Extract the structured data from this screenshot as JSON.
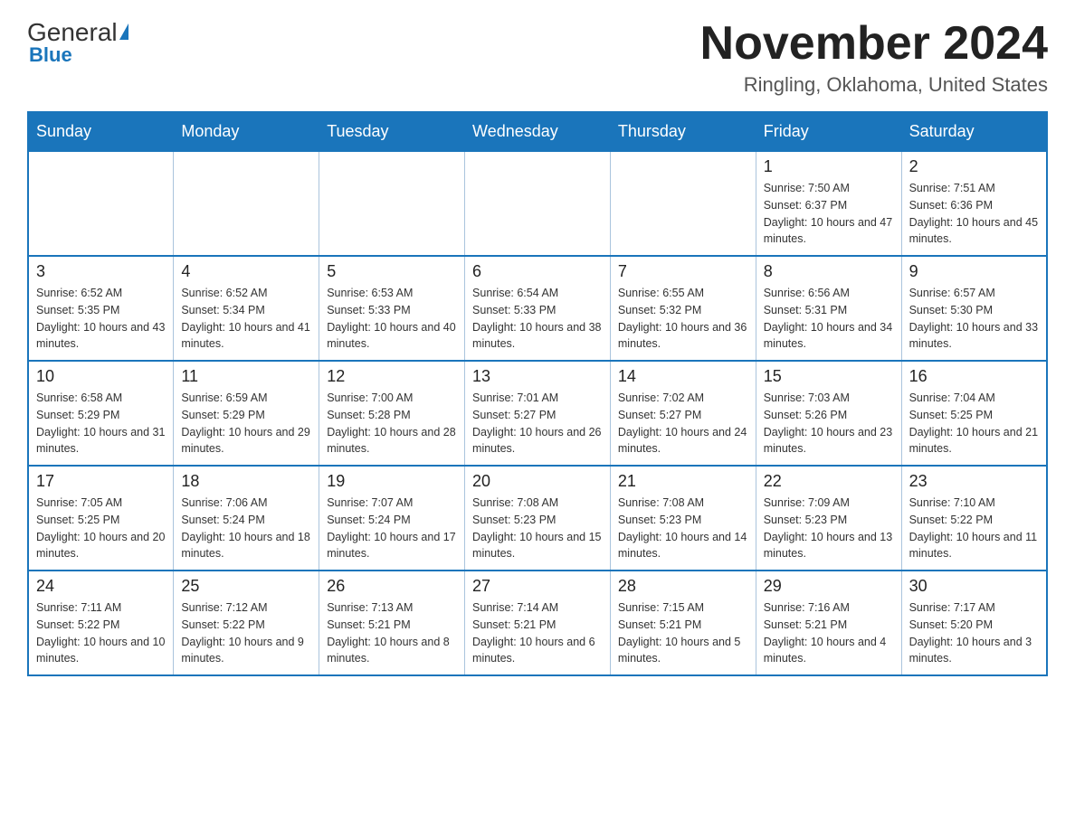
{
  "header": {
    "logo_general": "General",
    "logo_blue": "Blue",
    "month_title": "November 2024",
    "location": "Ringling, Oklahoma, United States"
  },
  "days_of_week": [
    "Sunday",
    "Monday",
    "Tuesday",
    "Wednesday",
    "Thursday",
    "Friday",
    "Saturday"
  ],
  "weeks": [
    {
      "cells": [
        {
          "day": "",
          "info": ""
        },
        {
          "day": "",
          "info": ""
        },
        {
          "day": "",
          "info": ""
        },
        {
          "day": "",
          "info": ""
        },
        {
          "day": "",
          "info": ""
        },
        {
          "day": "1",
          "info": "Sunrise: 7:50 AM\nSunset: 6:37 PM\nDaylight: 10 hours and 47 minutes."
        },
        {
          "day": "2",
          "info": "Sunrise: 7:51 AM\nSunset: 6:36 PM\nDaylight: 10 hours and 45 minutes."
        }
      ]
    },
    {
      "cells": [
        {
          "day": "3",
          "info": "Sunrise: 6:52 AM\nSunset: 5:35 PM\nDaylight: 10 hours and 43 minutes."
        },
        {
          "day": "4",
          "info": "Sunrise: 6:52 AM\nSunset: 5:34 PM\nDaylight: 10 hours and 41 minutes."
        },
        {
          "day": "5",
          "info": "Sunrise: 6:53 AM\nSunset: 5:33 PM\nDaylight: 10 hours and 40 minutes."
        },
        {
          "day": "6",
          "info": "Sunrise: 6:54 AM\nSunset: 5:33 PM\nDaylight: 10 hours and 38 minutes."
        },
        {
          "day": "7",
          "info": "Sunrise: 6:55 AM\nSunset: 5:32 PM\nDaylight: 10 hours and 36 minutes."
        },
        {
          "day": "8",
          "info": "Sunrise: 6:56 AM\nSunset: 5:31 PM\nDaylight: 10 hours and 34 minutes."
        },
        {
          "day": "9",
          "info": "Sunrise: 6:57 AM\nSunset: 5:30 PM\nDaylight: 10 hours and 33 minutes."
        }
      ]
    },
    {
      "cells": [
        {
          "day": "10",
          "info": "Sunrise: 6:58 AM\nSunset: 5:29 PM\nDaylight: 10 hours and 31 minutes."
        },
        {
          "day": "11",
          "info": "Sunrise: 6:59 AM\nSunset: 5:29 PM\nDaylight: 10 hours and 29 minutes."
        },
        {
          "day": "12",
          "info": "Sunrise: 7:00 AM\nSunset: 5:28 PM\nDaylight: 10 hours and 28 minutes."
        },
        {
          "day": "13",
          "info": "Sunrise: 7:01 AM\nSunset: 5:27 PM\nDaylight: 10 hours and 26 minutes."
        },
        {
          "day": "14",
          "info": "Sunrise: 7:02 AM\nSunset: 5:27 PM\nDaylight: 10 hours and 24 minutes."
        },
        {
          "day": "15",
          "info": "Sunrise: 7:03 AM\nSunset: 5:26 PM\nDaylight: 10 hours and 23 minutes."
        },
        {
          "day": "16",
          "info": "Sunrise: 7:04 AM\nSunset: 5:25 PM\nDaylight: 10 hours and 21 minutes."
        }
      ]
    },
    {
      "cells": [
        {
          "day": "17",
          "info": "Sunrise: 7:05 AM\nSunset: 5:25 PM\nDaylight: 10 hours and 20 minutes."
        },
        {
          "day": "18",
          "info": "Sunrise: 7:06 AM\nSunset: 5:24 PM\nDaylight: 10 hours and 18 minutes."
        },
        {
          "day": "19",
          "info": "Sunrise: 7:07 AM\nSunset: 5:24 PM\nDaylight: 10 hours and 17 minutes."
        },
        {
          "day": "20",
          "info": "Sunrise: 7:08 AM\nSunset: 5:23 PM\nDaylight: 10 hours and 15 minutes."
        },
        {
          "day": "21",
          "info": "Sunrise: 7:08 AM\nSunset: 5:23 PM\nDaylight: 10 hours and 14 minutes."
        },
        {
          "day": "22",
          "info": "Sunrise: 7:09 AM\nSunset: 5:23 PM\nDaylight: 10 hours and 13 minutes."
        },
        {
          "day": "23",
          "info": "Sunrise: 7:10 AM\nSunset: 5:22 PM\nDaylight: 10 hours and 11 minutes."
        }
      ]
    },
    {
      "cells": [
        {
          "day": "24",
          "info": "Sunrise: 7:11 AM\nSunset: 5:22 PM\nDaylight: 10 hours and 10 minutes."
        },
        {
          "day": "25",
          "info": "Sunrise: 7:12 AM\nSunset: 5:22 PM\nDaylight: 10 hours and 9 minutes."
        },
        {
          "day": "26",
          "info": "Sunrise: 7:13 AM\nSunset: 5:21 PM\nDaylight: 10 hours and 8 minutes."
        },
        {
          "day": "27",
          "info": "Sunrise: 7:14 AM\nSunset: 5:21 PM\nDaylight: 10 hours and 6 minutes."
        },
        {
          "day": "28",
          "info": "Sunrise: 7:15 AM\nSunset: 5:21 PM\nDaylight: 10 hours and 5 minutes."
        },
        {
          "day": "29",
          "info": "Sunrise: 7:16 AM\nSunset: 5:21 PM\nDaylight: 10 hours and 4 minutes."
        },
        {
          "day": "30",
          "info": "Sunrise: 7:17 AM\nSunset: 5:20 PM\nDaylight: 10 hours and 3 minutes."
        }
      ]
    }
  ]
}
